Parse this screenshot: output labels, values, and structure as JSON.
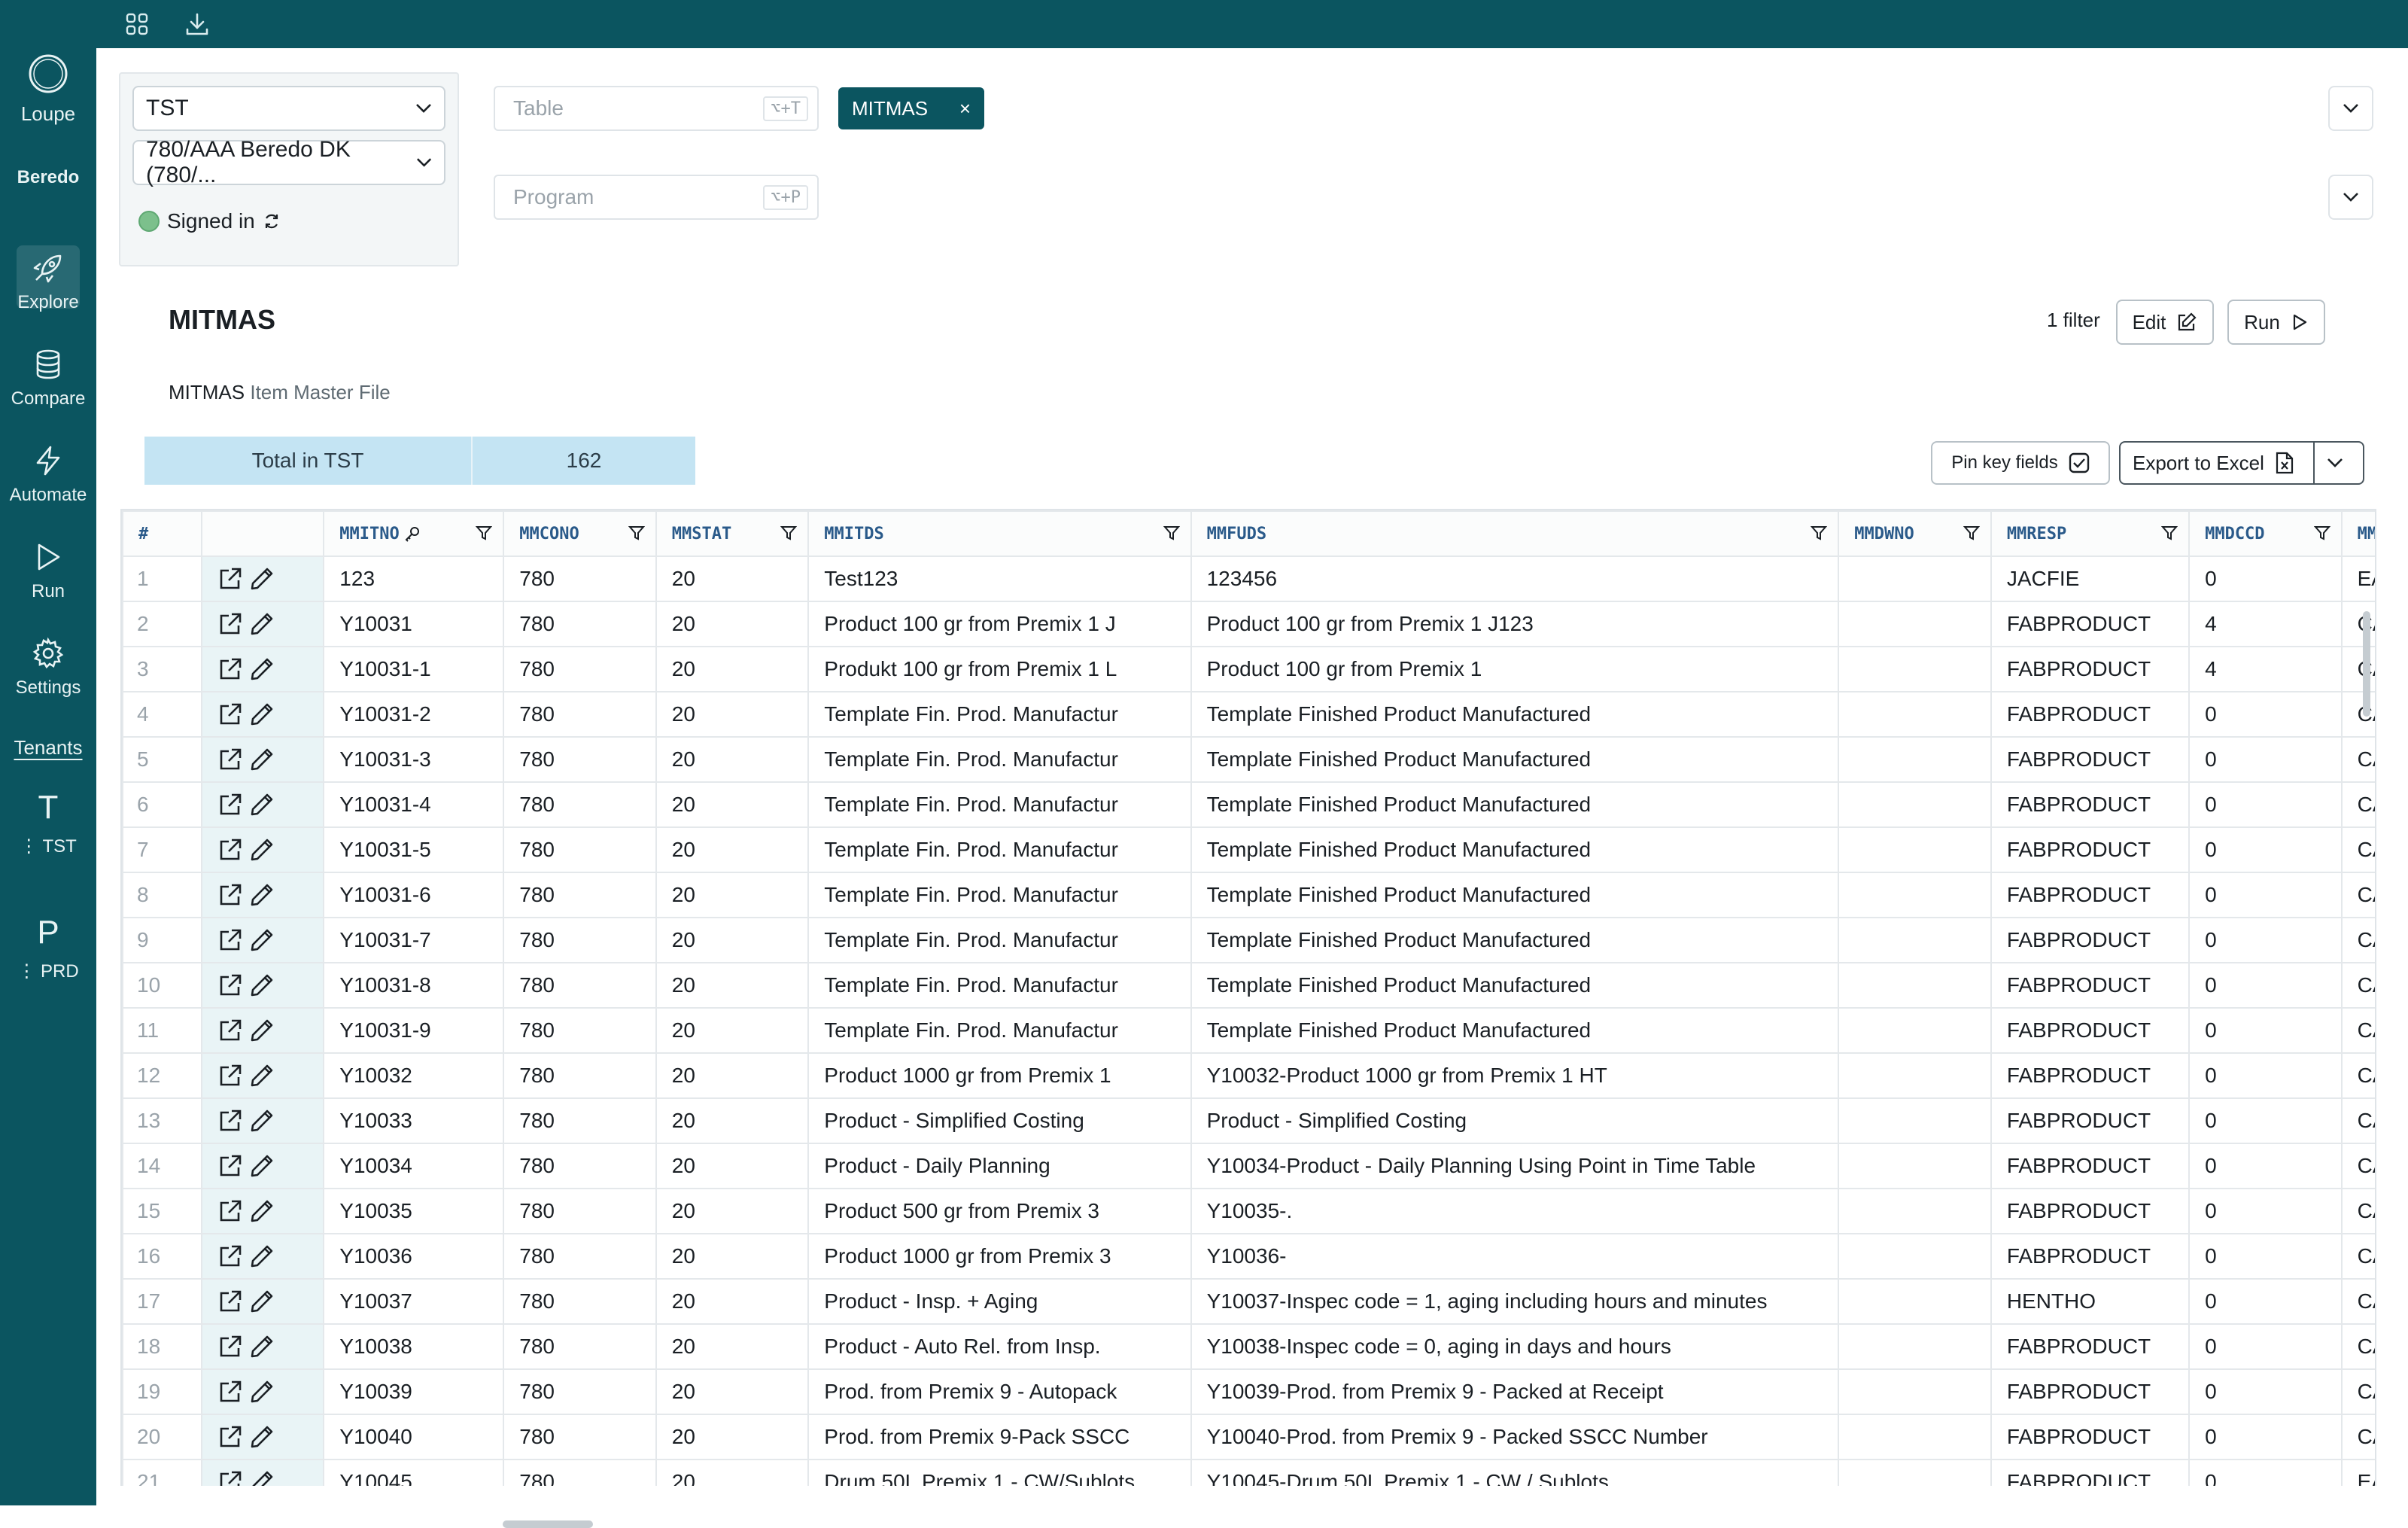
{
  "sidebar": {
    "app_label": "Loupe",
    "brand": "Beredo",
    "items": [
      {
        "label": "Explore",
        "icon": "rocket-icon"
      },
      {
        "label": "Compare",
        "icon": "database-icon"
      },
      {
        "label": "Automate",
        "icon": "lightning-icon"
      },
      {
        "label": "Run",
        "icon": "play-icon"
      },
      {
        "label": "Settings",
        "icon": "gear-icon"
      }
    ],
    "tenants_label": "Tenants",
    "tenants": [
      {
        "letter": "T",
        "label": "TST"
      },
      {
        "letter": "P",
        "label": "PRD"
      }
    ]
  },
  "selectors": {
    "env": "TST",
    "company": "780/AAA Beredo DK (780/...",
    "status": "Signed in"
  },
  "search": {
    "table_placeholder": "Table",
    "table_shortcut": "⌥+T",
    "program_placeholder": "Program",
    "program_shortcut": "⌥+P",
    "chip": "MITMAS"
  },
  "content": {
    "title": "MITMAS",
    "subtitle_name": "MITMAS",
    "subtitle_desc": "Item Master File",
    "filter_count": "1 filter",
    "edit_label": "Edit",
    "run_label": "Run",
    "total_label": "Total in TST",
    "total_value": "162",
    "pin_label": "Pin key fields",
    "export_label": "Export to Excel"
  },
  "table": {
    "headers": [
      "#",
      "",
      "MMITNO",
      "MMCONO",
      "MMSTAT",
      "MMITDS",
      "MMFUDS",
      "MMDWNO",
      "MMRESP",
      "MMDCCD",
      "MMUN"
    ],
    "rows": [
      [
        "1",
        "123",
        "780",
        "20",
        "Test123",
        "123456",
        "",
        "JACFIE",
        "0",
        "EA"
      ],
      [
        "2",
        "Y10031",
        "780",
        "20",
        "Product 100 gr from Premix 1 J",
        "Product 100 gr from Premix 1 J123",
        "",
        "FABPRODUCT",
        "4",
        "CAS"
      ],
      [
        "3",
        "Y10031-1",
        "780",
        "20",
        "Produkt 100 gr from Premix 1 L",
        "Product 100 gr from Premix 1",
        "",
        "FABPRODUCT",
        "4",
        "CAS"
      ],
      [
        "4",
        "Y10031-2",
        "780",
        "20",
        "Template Fin. Prod. Manufactur",
        "Template Finished Product Manufactured",
        "",
        "FABPRODUCT",
        "0",
        "CAS"
      ],
      [
        "5",
        "Y10031-3",
        "780",
        "20",
        "Template Fin. Prod. Manufactur",
        "Template Finished Product Manufactured",
        "",
        "FABPRODUCT",
        "0",
        "CAS"
      ],
      [
        "6",
        "Y10031-4",
        "780",
        "20",
        "Template Fin. Prod. Manufactur",
        "Template Finished Product Manufactured",
        "",
        "FABPRODUCT",
        "0",
        "CAS"
      ],
      [
        "7",
        "Y10031-5",
        "780",
        "20",
        "Template Fin. Prod. Manufactur",
        "Template Finished Product Manufactured",
        "",
        "FABPRODUCT",
        "0",
        "CAS"
      ],
      [
        "8",
        "Y10031-6",
        "780",
        "20",
        "Template Fin. Prod. Manufactur",
        "Template Finished Product Manufactured",
        "",
        "FABPRODUCT",
        "0",
        "CAS"
      ],
      [
        "9",
        "Y10031-7",
        "780",
        "20",
        "Template Fin. Prod. Manufactur",
        "Template Finished Product Manufactured",
        "",
        "FABPRODUCT",
        "0",
        "CAS"
      ],
      [
        "10",
        "Y10031-8",
        "780",
        "20",
        "Template Fin. Prod. Manufactur",
        "Template Finished Product Manufactured",
        "",
        "FABPRODUCT",
        "0",
        "CAS"
      ],
      [
        "11",
        "Y10031-9",
        "780",
        "20",
        "Template Fin. Prod. Manufactur",
        "Template Finished Product Manufactured",
        "",
        "FABPRODUCT",
        "0",
        "CAS"
      ],
      [
        "12",
        "Y10032",
        "780",
        "20",
        "Product 1000 gr from Premix 1",
        "Y10032-Product 1000 gr from Premix 1 HT",
        "",
        "FABPRODUCT",
        "0",
        "CAS"
      ],
      [
        "13",
        "Y10033",
        "780",
        "20",
        "Product - Simplified Costing",
        "Product - Simplified Costing",
        "",
        "FABPRODUCT",
        "0",
        "CAS"
      ],
      [
        "14",
        "Y10034",
        "780",
        "20",
        "Product - Daily Planning",
        "Y10034-Product - Daily Planning Using Point in Time Table",
        "",
        "FABPRODUCT",
        "0",
        "CAS"
      ],
      [
        "15",
        "Y10035",
        "780",
        "20",
        "Product 500 gr from Premix 3",
        "Y10035-.",
        "",
        "FABPRODUCT",
        "0",
        "CAS"
      ],
      [
        "16",
        "Y10036",
        "780",
        "20",
        "Product 1000 gr from Premix 3",
        "Y10036-",
        "",
        "FABPRODUCT",
        "0",
        "CAS"
      ],
      [
        "17",
        "Y10037",
        "780",
        "20",
        "Product - Insp. + Aging",
        "Y10037-Inspec code = 1, aging including hours and minutes",
        "",
        "HENTHO",
        "0",
        "CAS"
      ],
      [
        "18",
        "Y10038",
        "780",
        "20",
        "Product - Auto Rel. from Insp.",
        "Y10038-Inspec code = 0, aging in days and hours",
        "",
        "FABPRODUCT",
        "0",
        "CAS"
      ],
      [
        "19",
        "Y10039",
        "780",
        "20",
        "Prod. from Premix 9 - Autopack",
        "Y10039-Prod. from Premix 9 - Packed at Receipt",
        "",
        "FABPRODUCT",
        "0",
        "CAS"
      ],
      [
        "20",
        "Y10040",
        "780",
        "20",
        "Prod. from Premix 9-Pack SSCC",
        "Y10040-Prod. from Premix 9 - Packed SSCC Number",
        "",
        "FABPRODUCT",
        "0",
        "CAS"
      ],
      [
        "21",
        "Y10045",
        "780",
        "20",
        "Drum 50L Premix 1 - CW/Sublots",
        "Y10045-Drum 50L Premix 1 - CW / Sublots",
        "",
        "FABPRODUCT",
        "0",
        "EA"
      ]
    ]
  },
  "colors": {
    "brand": "#0b5560",
    "total_bar": "#c4e4f3",
    "edit_column": "#e9f4f6",
    "header_text": "#2a5a8a"
  }
}
